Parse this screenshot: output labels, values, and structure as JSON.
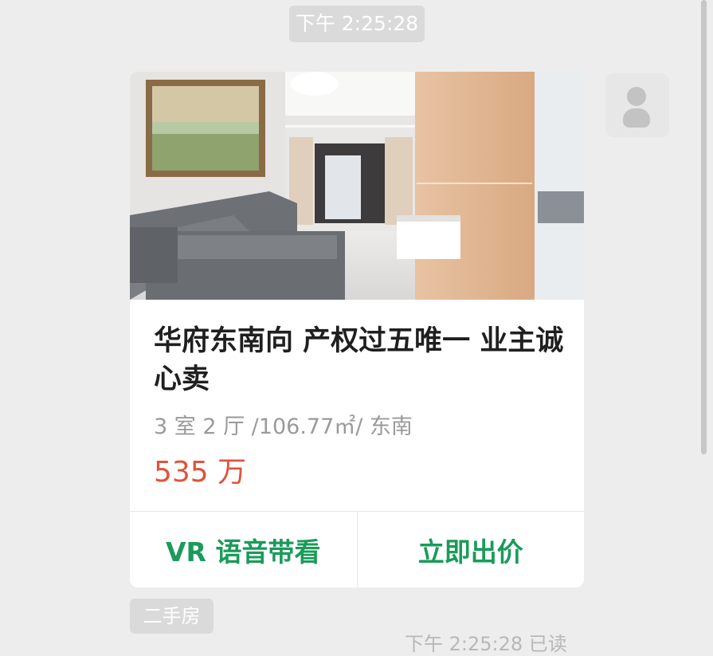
{
  "chat": {
    "timestamp": "下午 2:25:28"
  },
  "listing": {
    "title": "华府东南向 产权过五唯一 业主诚心卖",
    "specs": "3 室 2 厅 /106.77㎡/ 东南",
    "price": "535 万",
    "actions": {
      "vr_label": "VR 语音带看",
      "bid_label": "立即出价"
    }
  },
  "tag": {
    "label": "二手房"
  },
  "footer": {
    "time_partial": "下午 2:25:28 已读"
  },
  "colors": {
    "accent_green": "#1a9b5a",
    "price_red": "#e0533b",
    "background": "#ededed"
  }
}
